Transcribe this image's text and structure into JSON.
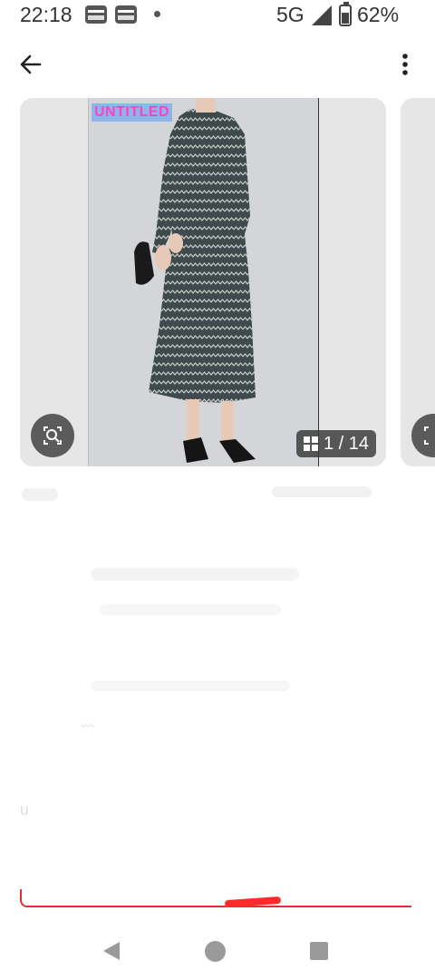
{
  "status_bar": {
    "time": "22:18",
    "network": "5G",
    "battery": "62%"
  },
  "app_bar": {
    "back_icon": "arrow-left-icon",
    "more_icon": "more-vertical-icon"
  },
  "gallery": {
    "watermark": "UNTITLED",
    "counter": "1 / 14",
    "visual_search_icon": "visual-search-icon",
    "grid_icon": "grid-icon"
  },
  "faded_content": {
    "snippet": "ᵕᵕᵕ",
    "snippet2": "ᑌ"
  },
  "nav_bar": {
    "back_icon": "triangle-back-icon",
    "home_icon": "circle-home-icon",
    "recents_icon": "square-recents-icon"
  },
  "colors": {
    "accent_red": "#ff2a2a",
    "watermark_bg": "#8fb4e8",
    "watermark_text": "#ff40c8"
  }
}
